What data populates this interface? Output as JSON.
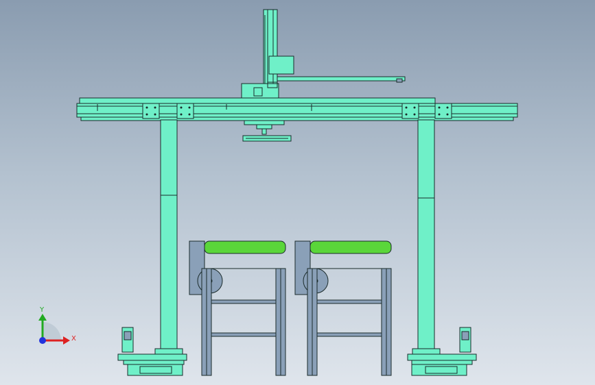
{
  "triad": {
    "y_label": "Y",
    "x_label": "X",
    "y_color": "#22aa22",
    "x_color": "#dd2222",
    "z_color": "#2233dd"
  },
  "colors": {
    "part_fill": "#6ff0c8",
    "roller_fill": "#5ad63a",
    "frame_fill": "#8aa0b8",
    "outline": "#1a2a2a"
  }
}
